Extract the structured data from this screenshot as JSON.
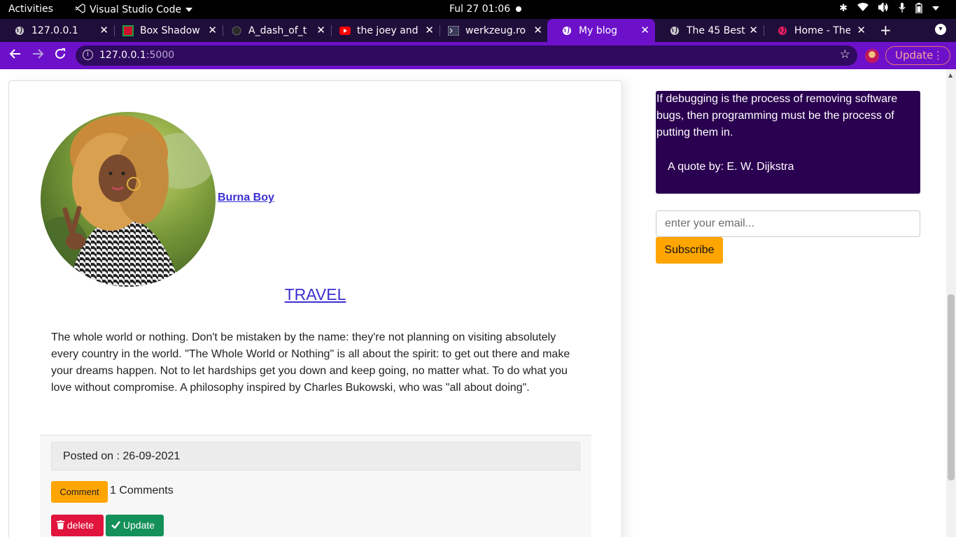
{
  "system_bar": {
    "activities": "Activities",
    "app_name": "Visual Studio Code",
    "clock": "Ful 27  01:06"
  },
  "tabs": [
    {
      "title": "127.0.0.1",
      "icon": "globe-icon"
    },
    {
      "title": "Box Shadow",
      "icon": "box-shadow-favicon"
    },
    {
      "title": "A_dash_of_t",
      "icon": "github-icon"
    },
    {
      "title": "the joey and",
      "icon": "youtube-icon"
    },
    {
      "title": "werkzeug.ro",
      "icon": "terminal-icon"
    },
    {
      "title": "My blog",
      "icon": "globe-icon",
      "active": true
    },
    {
      "title": "The 45 Best T",
      "icon": "globe-icon"
    },
    {
      "title": "Home - The W",
      "icon": "world-icon"
    }
  ],
  "toolbar": {
    "url_host": "127.0.0.1",
    "url_port": ":5000",
    "update_label": "Update",
    "accent": "#6c11c9"
  },
  "post": {
    "author": "Burna Boy",
    "title": "TRAVEL",
    "body": "The whole world or nothing. Don't be mistaken by the name: they're not planning on visiting absolutely every country in the world. \"The Whole World or Nothing\" is all about the spirit: to get out there and make your dreams happen. Not to let hardships get you down and keep going, no matter what. To do what you love without compromise. A philosophy inspired by Charles Bukowski, who was \"all about doing\".",
    "posted_on": "Posted on : 26-09-2021",
    "comment_label": "Comment",
    "comment_count": "1 Comments",
    "delete_label": "delete",
    "update_label": "Update"
  },
  "sidebar": {
    "quote_text": "If debugging is the process of removing software bugs, then programming must be the process of putting them in.",
    "quote_author": "A quote by: E. W. Dijkstra",
    "email_placeholder": "enter your email...",
    "subscribe_label": "Subscribe",
    "quote_bg": "#2a0050",
    "button_color": "#ffa500"
  }
}
